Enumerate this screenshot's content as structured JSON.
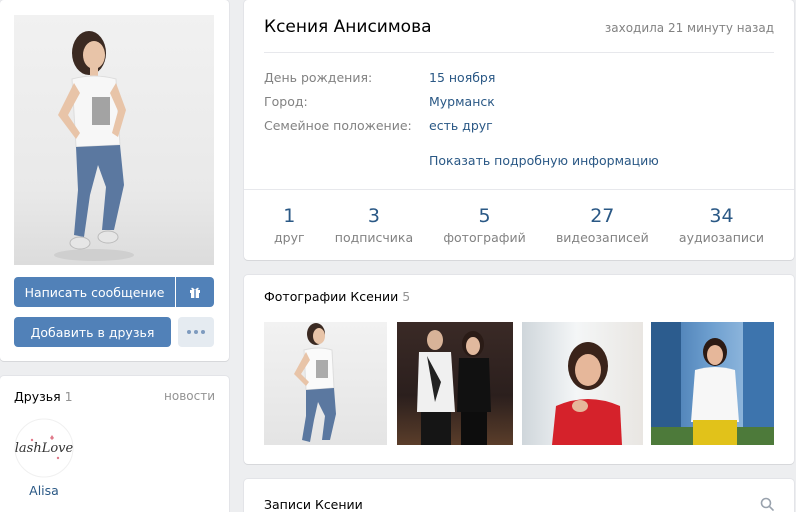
{
  "profile": {
    "name": "Ксения Анисимова",
    "last_seen": "заходила 21 минуту назад",
    "info": [
      {
        "label": "День рождения:",
        "value": "15 ноября"
      },
      {
        "label": "Город:",
        "value": "Мурманск"
      },
      {
        "label": "Семейное положение:",
        "value": "есть друг"
      }
    ],
    "show_more": "Показать подробную информацию",
    "counters": [
      {
        "num": "1",
        "label": "друг"
      },
      {
        "num": "3",
        "label": "подписчика"
      },
      {
        "num": "5",
        "label": "фотографий"
      },
      {
        "num": "27",
        "label": "видеозаписей"
      },
      {
        "num": "34",
        "label": "аудиозаписи"
      }
    ]
  },
  "actions": {
    "message": "Написать сообщение",
    "add_friend": "Добавить в друзья",
    "gift_icon": "gift-icon",
    "more_icon": "more-icon"
  },
  "friends": {
    "title": "Друзья",
    "count": "1",
    "news": "новости",
    "items": [
      {
        "name": "Alisa",
        "avatar_text": "lashLove"
      }
    ]
  },
  "photos": {
    "title": "Фотографии Ксении",
    "count": "5"
  },
  "wall": {
    "title": "Записи Ксении",
    "search_icon": "search-icon"
  },
  "colors": {
    "link": "#2a5885",
    "button": "#5181b8",
    "background": "#edeef0"
  }
}
